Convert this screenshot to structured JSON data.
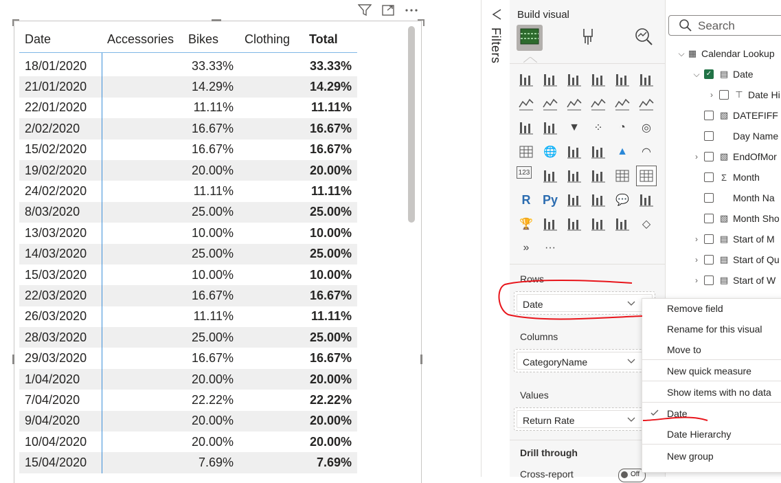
{
  "visual_header": {
    "filter_icon": "filter-icon",
    "focus_icon": "focus-mode-icon",
    "more_icon": "more-options-icon"
  },
  "table": {
    "columns": [
      "Date",
      "Accessories",
      "Bikes",
      "Clothing",
      "Total"
    ],
    "rows": [
      {
        "date": "18/01/2020",
        "bikes": "33.33%",
        "total": "33.33%"
      },
      {
        "date": "21/01/2020",
        "bikes": "14.29%",
        "total": "14.29%"
      },
      {
        "date": "22/01/2020",
        "bikes": "11.11%",
        "total": "11.11%"
      },
      {
        "date": "2/02/2020",
        "bikes": "16.67%",
        "total": "16.67%"
      },
      {
        "date": "15/02/2020",
        "bikes": "16.67%",
        "total": "16.67%"
      },
      {
        "date": "19/02/2020",
        "bikes": "20.00%",
        "total": "20.00%"
      },
      {
        "date": "24/02/2020",
        "bikes": "11.11%",
        "total": "11.11%"
      },
      {
        "date": "8/03/2020",
        "bikes": "25.00%",
        "total": "25.00%"
      },
      {
        "date": "13/03/2020",
        "bikes": "10.00%",
        "total": "10.00%"
      },
      {
        "date": "14/03/2020",
        "bikes": "25.00%",
        "total": "25.00%"
      },
      {
        "date": "15/03/2020",
        "bikes": "10.00%",
        "total": "10.00%"
      },
      {
        "date": "22/03/2020",
        "bikes": "16.67%",
        "total": "16.67%"
      },
      {
        "date": "26/03/2020",
        "bikes": "11.11%",
        "total": "11.11%"
      },
      {
        "date": "28/03/2020",
        "bikes": "25.00%",
        "total": "25.00%"
      },
      {
        "date": "29/03/2020",
        "bikes": "16.67%",
        "total": "16.67%"
      },
      {
        "date": "1/04/2020",
        "bikes": "20.00%",
        "total": "20.00%"
      },
      {
        "date": "7/04/2020",
        "bikes": "22.22%",
        "total": "22.22%"
      },
      {
        "date": "9/04/2020",
        "bikes": "20.00%",
        "total": "20.00%"
      },
      {
        "date": "10/04/2020",
        "bikes": "20.00%",
        "total": "20.00%"
      },
      {
        "date": "15/04/2020",
        "bikes": "7.69%",
        "total": "7.69%"
      }
    ]
  },
  "filters": {
    "label": "Filters"
  },
  "build": {
    "title": "Build visual",
    "sections": {
      "rows": {
        "label": "Rows",
        "field": "Date"
      },
      "columns": {
        "label": "Columns",
        "field": "CategoryName"
      },
      "values": {
        "label": "Values",
        "field": "Return Rate"
      },
      "drill": {
        "label": "Drill through",
        "cross_report": "Cross-report",
        "toggle": "Off"
      }
    },
    "more": "···"
  },
  "data_pane": {
    "search_placeholder": "Search",
    "fields": [
      {
        "label": "Calendar Lookup",
        "indent": 0,
        "chevron": "down",
        "checkbox": false,
        "icon": "table-icon"
      },
      {
        "label": "Date",
        "indent": 1,
        "chevron": "down",
        "checkbox": true,
        "checked": true,
        "icon": "calendar-icon"
      },
      {
        "label": "Date Hi",
        "indent": 2,
        "chevron": "right",
        "checkbox": true,
        "icon": "hierarchy-icon"
      },
      {
        "label": "DATEFIFF",
        "indent": 1,
        "chevron": "",
        "checkbox": true,
        "icon": "calc-column-icon"
      },
      {
        "label": "Day Name",
        "indent": 1,
        "chevron": "",
        "checkbox": true,
        "icon": ""
      },
      {
        "label": "EndOfMor",
        "indent": 1,
        "chevron": "right",
        "checkbox": true,
        "icon": "calc-column-icon"
      },
      {
        "label": "Month",
        "indent": 1,
        "chevron": "",
        "checkbox": true,
        "icon": "sigma-icon"
      },
      {
        "label": "Month Na",
        "indent": 1,
        "chevron": "",
        "checkbox": true,
        "icon": ""
      },
      {
        "label": "Month Sho",
        "indent": 1,
        "chevron": "",
        "checkbox": true,
        "icon": "calc-column-icon"
      },
      {
        "label": "Start of M",
        "indent": 1,
        "chevron": "right",
        "checkbox": true,
        "icon": "calendar-icon"
      },
      {
        "label": "Start of Qu",
        "indent": 1,
        "chevron": "right",
        "checkbox": true,
        "icon": "calendar-icon"
      },
      {
        "label": "Start of W",
        "indent": 1,
        "chevron": "right",
        "checkbox": true,
        "icon": "calendar-icon"
      }
    ]
  },
  "context_menu": {
    "items": [
      "Remove field",
      "Rename for this visual",
      "Move to",
      "New quick measure",
      "Show items with no data",
      "Date",
      "Date Hierarchy",
      "New group"
    ],
    "checked": "Date"
  },
  "colors": {
    "annotation": "#e8141a",
    "accent": "#3b8fd9",
    "checkbox_on": "#217346"
  }
}
